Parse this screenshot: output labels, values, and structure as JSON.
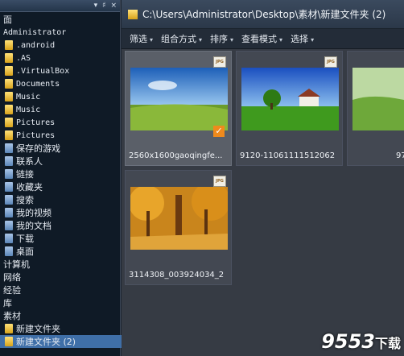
{
  "left_pane": {
    "header_icons": [
      "pin-icon",
      "close-icon"
    ],
    "header_glyphs": [
      "▾",
      "♯",
      "×"
    ],
    "items": [
      {
        "label": "面",
        "icon": "none"
      },
      {
        "label": "Administrator",
        "icon": "none"
      },
      {
        "label": ".android",
        "icon": "folder"
      },
      {
        "label": ".AS",
        "icon": "folder"
      },
      {
        "label": ".VirtualBox",
        "icon": "folder"
      },
      {
        "label": "Documents",
        "icon": "folder"
      },
      {
        "label": "Music",
        "icon": "folder"
      },
      {
        "label": "Music",
        "icon": "folder"
      },
      {
        "label": "Pictures",
        "icon": "folder"
      },
      {
        "label": "Pictures",
        "icon": "folder"
      },
      {
        "label": "保存的游戏",
        "icon": "special"
      },
      {
        "label": "联系人",
        "icon": "special"
      },
      {
        "label": "链接",
        "icon": "special"
      },
      {
        "label": "收藏夹",
        "icon": "special"
      },
      {
        "label": "搜索",
        "icon": "special"
      },
      {
        "label": "我的视频",
        "icon": "special"
      },
      {
        "label": "我的文档",
        "icon": "special"
      },
      {
        "label": "下载",
        "icon": "special"
      },
      {
        "label": "桌面",
        "icon": "special"
      },
      {
        "label": "计算机",
        "icon": "none"
      },
      {
        "label": "网络",
        "icon": "none"
      },
      {
        "label": "经验",
        "icon": "none"
      },
      {
        "label": "库",
        "icon": "none"
      },
      {
        "label": "素材",
        "icon": "none"
      },
      {
        "label": "新建文件夹",
        "icon": "folder"
      },
      {
        "label": "新建文件夹 (2)",
        "icon": "folder",
        "selected": true
      }
    ]
  },
  "address_bar": {
    "path": "C:\\Users\\Administrator\\Desktop\\素材\\新建文件夹 (2)"
  },
  "toolbar": {
    "items": [
      "筛选",
      "组合方式",
      "排序",
      "查看模式",
      "选择"
    ],
    "dropdown_glyph": "▾"
  },
  "files": [
    {
      "name": "2560x1600gaoqingfe...",
      "type_badge": "JPG",
      "selected": true,
      "checked": true,
      "check_glyph": "✓"
    },
    {
      "name": "9120-11061111512062",
      "type_badge": "JPG",
      "selected": false
    },
    {
      "name": "97",
      "type_badge": "",
      "selected": false
    },
    {
      "name": "3114308_003924034_2",
      "type_badge": "JPG",
      "selected": false
    }
  ],
  "watermark": {
    "text": "9553",
    "sub": "下载"
  },
  "colors": {
    "accent": "#3f6fa8",
    "check": "#f08a1c"
  }
}
